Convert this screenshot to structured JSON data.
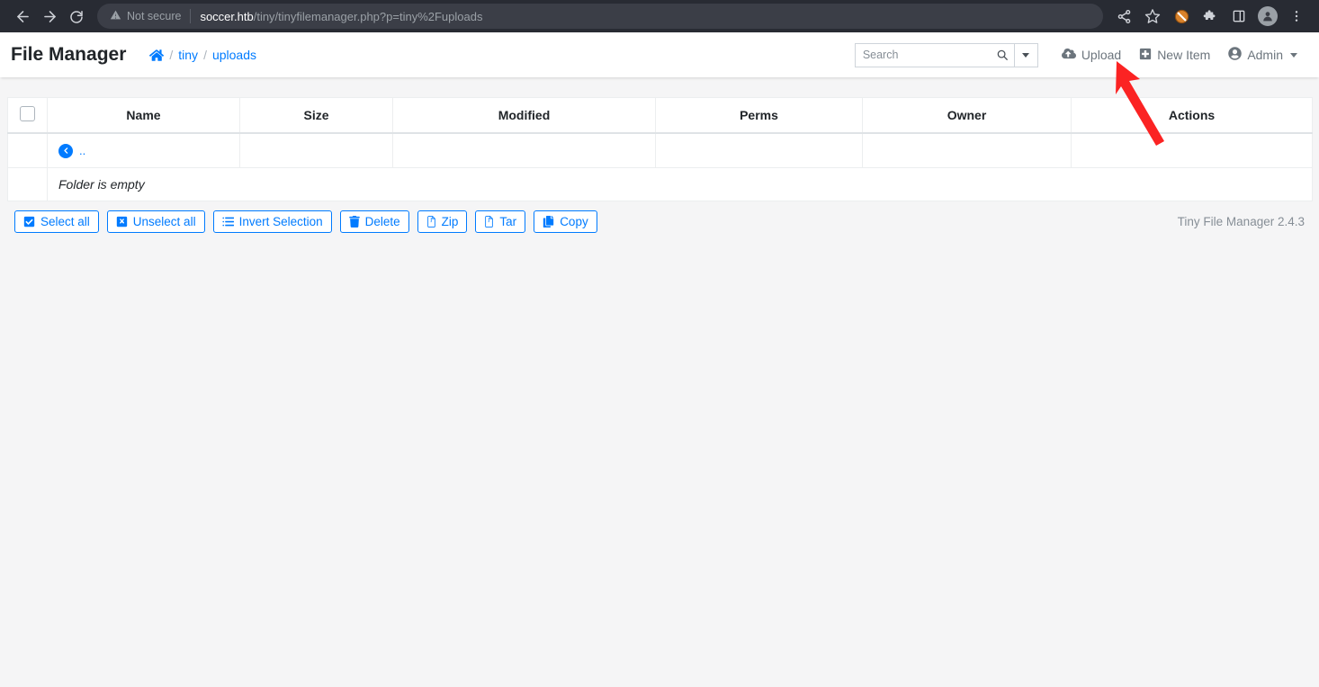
{
  "browser": {
    "back_icon": "back-arrow-icon",
    "forward_icon": "forward-arrow-icon",
    "reload_icon": "reload-icon",
    "security_label": "Not secure",
    "security_icon": "warning-triangle-icon",
    "url_host": "soccer.htb",
    "url_path": "/tiny/tinyfilemanager.php?p=tiny%2Fuploads",
    "actions": [
      {
        "name": "share-icon",
        "label": "Share"
      },
      {
        "name": "bookmark-star-icon",
        "label": "Bookmark"
      },
      {
        "name": "adblock-icon",
        "label": "Ad Blocker"
      },
      {
        "name": "extensions-puzzle-icon",
        "label": "Extensions"
      },
      {
        "name": "side-panel-icon",
        "label": "Side panel"
      },
      {
        "name": "profile-avatar-icon",
        "label": "Profile"
      },
      {
        "name": "kebab-menu-icon",
        "label": "Customize and control"
      }
    ]
  },
  "app": {
    "brand": "File Manager",
    "breadcrumb": {
      "home_icon": "home-icon",
      "separator": "/",
      "items": [
        {
          "label": "tiny"
        },
        {
          "label": "uploads"
        }
      ]
    },
    "search": {
      "placeholder": "Search",
      "value": "",
      "icon": "search-icon",
      "caret_icon": "chevron-down-icon"
    },
    "nav_links": [
      {
        "name": "upload-link",
        "label": "Upload",
        "icon": "cloud-upload-icon"
      },
      {
        "name": "new-item-link",
        "label": "New Item",
        "icon": "plus-square-icon"
      },
      {
        "name": "admin-menu",
        "label": "Admin",
        "icon": "user-circle-icon",
        "caret": true
      }
    ]
  },
  "table": {
    "headers": [
      "",
      "Name",
      "Size",
      "Modified",
      "Perms",
      "Owner",
      "Actions"
    ],
    "parent_row": {
      "icon": "back-circle-icon",
      "label": ".."
    },
    "empty_message": "Folder is empty"
  },
  "toolbar": {
    "buttons": [
      {
        "name": "select-all-button",
        "label": "Select all",
        "icon": "checked-box-icon"
      },
      {
        "name": "unselect-all-button",
        "label": "Unselect all",
        "icon": "x-square-icon"
      },
      {
        "name": "invert-selection-button",
        "label": "Invert Selection",
        "icon": "list-icon"
      },
      {
        "name": "delete-button",
        "label": "Delete",
        "icon": "trash-icon"
      },
      {
        "name": "zip-button",
        "label": "Zip",
        "icon": "file-archive-icon"
      },
      {
        "name": "tar-button",
        "label": "Tar",
        "icon": "file-archive-icon"
      },
      {
        "name": "copy-button",
        "label": "Copy",
        "icon": "copy-icon"
      }
    ],
    "version": "Tiny File Manager 2.4.3"
  },
  "annotation": {
    "color": "#fb2323",
    "points_to": "Upload"
  }
}
